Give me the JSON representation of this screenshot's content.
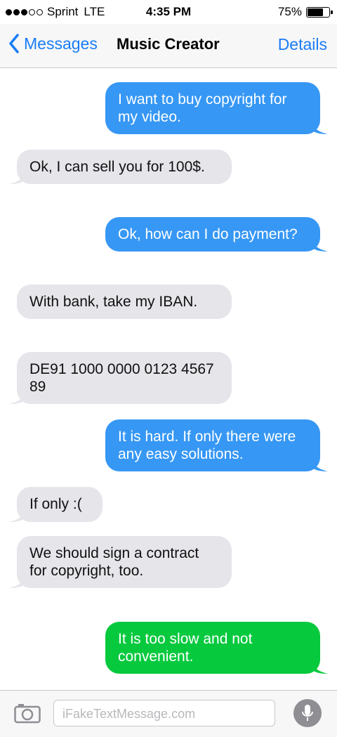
{
  "status_bar": {
    "carrier": "Sprint",
    "network": "LTE",
    "time": "4:35 PM",
    "battery": "75%",
    "battery_level": 0.75,
    "signal_bars": 3
  },
  "nav": {
    "back_label": "Messages",
    "title": "Music Creator",
    "details_label": "Details"
  },
  "messages": [
    {
      "from": "me",
      "text": "I want to buy copyright for my video."
    },
    {
      "from": "them",
      "text": "Ok, I can sell you for 100$."
    },
    {
      "from": "me",
      "text": "Ok, how can I do payment?"
    },
    {
      "from": "them",
      "text": "With bank, take my IBAN."
    },
    {
      "from": "them",
      "text": "DE91 1000 0000 0123 4567 89"
    },
    {
      "from": "me",
      "text": "It is hard. If only there were any easy solutions."
    },
    {
      "from": "them",
      "text": "If only :("
    },
    {
      "from": "them",
      "text": "We should sign a contract for copyright, too."
    },
    {
      "from": "me",
      "text": "It is too slow and not convenient.",
      "color": "#07c93e"
    }
  ],
  "composer": {
    "placeholder": "iFakeTextMessage.com"
  },
  "colors": {
    "accent": "#1a7cf4",
    "sent_bubble": "#3697f4",
    "received_bubble": "#e5e5ea",
    "sms_bubble": "#07c93e"
  }
}
